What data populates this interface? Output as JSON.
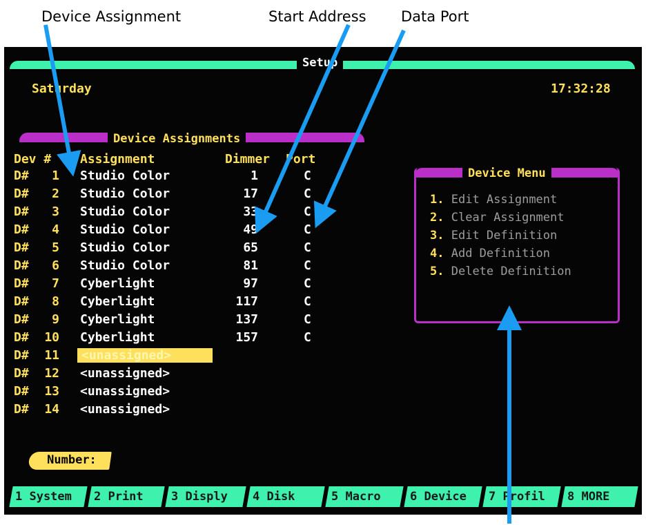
{
  "callouts": {
    "device_assignment": "Device Assignment",
    "start_address": "Start Address",
    "data_port": "Data Port"
  },
  "screen": {
    "title": "Setup",
    "day": "Saturday",
    "time": "17:32:28",
    "panel_title": "Device Assignments",
    "headers": {
      "dev": "Dev #",
      "assignment": "Assignment",
      "dimmer": "Dimmer",
      "port": "Port"
    },
    "rows": [
      {
        "dev": "D#",
        "num": "1",
        "assignment": "Studio Color",
        "dimmer": "1",
        "port": "C"
      },
      {
        "dev": "D#",
        "num": "2",
        "assignment": "Studio Color",
        "dimmer": "17",
        "port": "C"
      },
      {
        "dev": "D#",
        "num": "3",
        "assignment": "Studio Color",
        "dimmer": "33",
        "port": "C"
      },
      {
        "dev": "D#",
        "num": "4",
        "assignment": "Studio Color",
        "dimmer": "49",
        "port": "C"
      },
      {
        "dev": "D#",
        "num": "5",
        "assignment": "Studio Color",
        "dimmer": "65",
        "port": "C"
      },
      {
        "dev": "D#",
        "num": "6",
        "assignment": "Studio Color",
        "dimmer": "81",
        "port": "C"
      },
      {
        "dev": "D#",
        "num": "7",
        "assignment": "Cyberlight",
        "dimmer": "97",
        "port": "C"
      },
      {
        "dev": "D#",
        "num": "8",
        "assignment": "Cyberlight",
        "dimmer": "117",
        "port": "C"
      },
      {
        "dev": "D#",
        "num": "9",
        "assignment": "Cyberlight",
        "dimmer": "137",
        "port": "C"
      },
      {
        "dev": "D#",
        "num": "10",
        "assignment": "Cyberlight",
        "dimmer": "157",
        "port": "C"
      },
      {
        "dev": "D#",
        "num": "11",
        "assignment": "<unassigned>",
        "dimmer": "",
        "port": "",
        "selected": true
      },
      {
        "dev": "D#",
        "num": "12",
        "assignment": "<unassigned>",
        "dimmer": "",
        "port": ""
      },
      {
        "dev": "D#",
        "num": "13",
        "assignment": "<unassigned>",
        "dimmer": "",
        "port": ""
      },
      {
        "dev": "D#",
        "num": "14",
        "assignment": "<unassigned>",
        "dimmer": "",
        "port": ""
      }
    ],
    "device_menu": {
      "title": "Device Menu",
      "items": [
        {
          "key": "1.",
          "label": "Edit Assignment"
        },
        {
          "key": "2.",
          "label": "Clear Assignment"
        },
        {
          "key": "3.",
          "label": "Edit Definition"
        },
        {
          "key": "4.",
          "label": "Add Definition"
        },
        {
          "key": "5.",
          "label": "Delete Definition"
        }
      ]
    },
    "number_prompt": "Number:",
    "function_keys": [
      "1 System",
      "2 Print",
      "3 Disply",
      "4 Disk",
      "5 Macro",
      "6 Device",
      "7 Profil",
      "8 MORE"
    ]
  },
  "colors": {
    "screen_bg": "#050505",
    "accent_green": "#3ef2ad",
    "accent_magenta": "#b92fc8",
    "text_yellow": "#ffe05c",
    "arrow_blue": "#1a9cf2"
  }
}
